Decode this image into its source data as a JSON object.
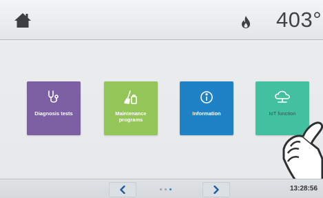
{
  "header": {
    "temperature": "403°",
    "home_icon": "home-icon",
    "flame_icon": "flame-icon"
  },
  "tiles": [
    {
      "label": "Diagnosis tests",
      "icon": "stethoscope-icon",
      "color": "#7d5fa3"
    },
    {
      "label": "Maintenance programs",
      "icon": "broom-icon",
      "color": "#94c559"
    },
    {
      "label": "Information",
      "icon": "info-icon",
      "color": "#1f82c7"
    },
    {
      "label": "IoT function",
      "icon": "cloud-icon",
      "color": "#43c0a0"
    }
  ],
  "footer": {
    "time": "13:28:56",
    "page_dots": 3,
    "active_dot": 3
  }
}
